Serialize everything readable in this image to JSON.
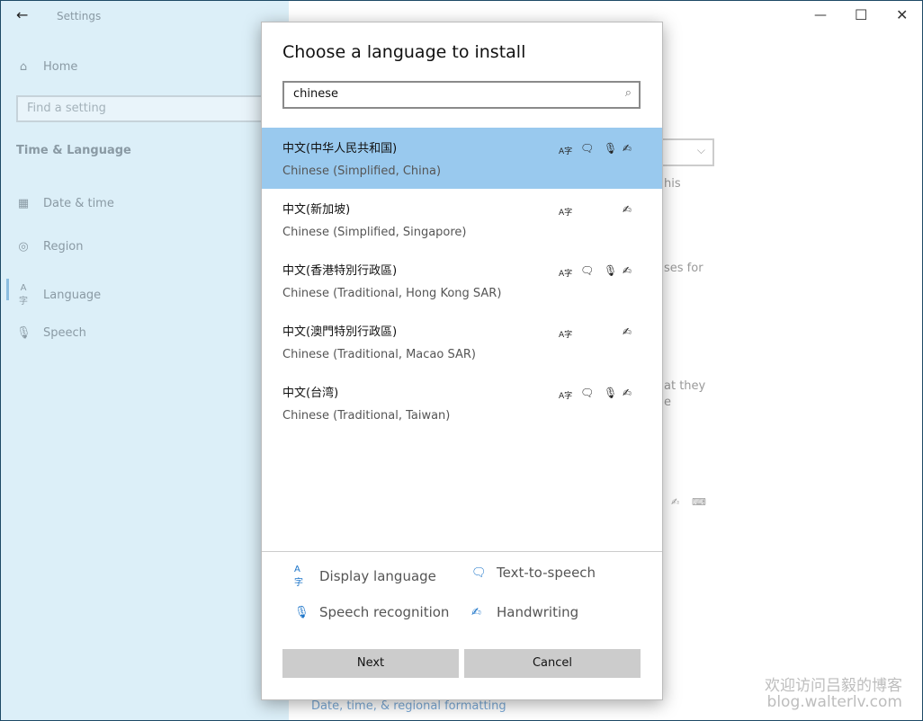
{
  "window": {
    "title": "Settings",
    "controls": [
      "minimize",
      "maximize",
      "close"
    ]
  },
  "sidebar": {
    "home": "Home",
    "search_placeholder": "Find a setting",
    "section": "Time & Language",
    "items": [
      {
        "label": "Date & time",
        "icon": "calendar-clock-icon"
      },
      {
        "label": "Region",
        "icon": "globe-icon"
      },
      {
        "label": "Language",
        "icon": "language-icon",
        "selected": true
      },
      {
        "label": "Speech",
        "icon": "microphone-icon"
      }
    ]
  },
  "background": {
    "frag1": "his",
    "frag2": "ses for",
    "frag3": "at they",
    "frag4": "e",
    "link": "Date, time, & regional formatting"
  },
  "dialog": {
    "title": "Choose a language to install",
    "search_value": "chinese",
    "languages": [
      {
        "native": "中文(中华人民共和国)",
        "name": "Chinese (Simplified, China)",
        "display": true,
        "tts": true,
        "speech": true,
        "handwriting": true,
        "selected": true
      },
      {
        "native": "中文(新加坡)",
        "name": "Chinese (Simplified, Singapore)",
        "display": true,
        "tts": false,
        "speech": false,
        "handwriting": true
      },
      {
        "native": "中文(香港特別行政區)",
        "name": "Chinese (Traditional, Hong Kong SAR)",
        "display": true,
        "tts": true,
        "speech": true,
        "handwriting": true
      },
      {
        "native": "中文(澳門特別行政區)",
        "name": "Chinese (Traditional, Macao SAR)",
        "display": true,
        "tts": false,
        "speech": false,
        "handwriting": true
      },
      {
        "native": "中文(台湾)",
        "name": "Chinese (Traditional, Taiwan)",
        "display": true,
        "tts": true,
        "speech": true,
        "handwriting": true
      }
    ],
    "legend": {
      "display": "Display language",
      "tts": "Text-to-speech",
      "speech": "Speech recognition",
      "handwriting": "Handwriting"
    },
    "next": "Next",
    "cancel": "Cancel"
  },
  "watermark": {
    "line1": "欢迎访问吕毅的博客",
    "line2": "blog.walterlv.com"
  },
  "colors": {
    "selected_row": "#99c9ee",
    "accent": "#1a73c8",
    "sidebar_bg": "#dcefF8"
  }
}
